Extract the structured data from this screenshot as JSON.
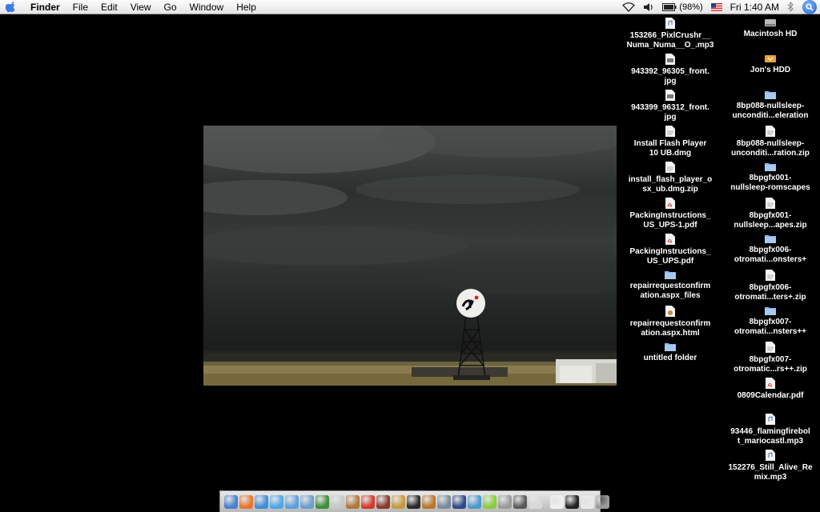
{
  "menubar": {
    "app_name": "Finder",
    "menus": [
      "File",
      "Edit",
      "View",
      "Go",
      "Window",
      "Help"
    ],
    "battery": "(98%)",
    "clock": "Fri 1:40 AM"
  },
  "desktop_left": [
    {
      "label": "153266_PixlCrushr__\nNuma_Numa__O_.mp3",
      "icon": "audio-file-icon"
    },
    {
      "label": "943392_96305_front.\njpg",
      "icon": "image-file-icon"
    },
    {
      "label": "943399_96312_front.\njpg",
      "icon": "image-file-icon"
    },
    {
      "label": "Install Flash Player\n10 UB.dmg",
      "icon": "document-icon"
    },
    {
      "label": "install_flash_player_o\nsx_ub.dmg.zip",
      "icon": "document-icon"
    },
    {
      "label": "PackingInstructions_\nUS_UPS-1.pdf",
      "icon": "pdf-file-icon"
    },
    {
      "label": "PackingInstructions_\nUS_UPS.pdf",
      "icon": "pdf-file-icon"
    },
    {
      "label": "repairrequestconfirm\nation.aspx_files",
      "icon": "folder-icon"
    },
    {
      "label": "repairrequestconfirm\nation.aspx.html",
      "icon": "html-file-icon"
    },
    {
      "label": "untitled folder",
      "icon": "folder-icon"
    }
  ],
  "desktop_right": [
    {
      "label": "Macintosh HD",
      "icon": "hard-drive-icon"
    },
    {
      "label": "Jon's HDD",
      "icon": "external-drive-icon"
    },
    {
      "label": "8bp088-nullsleep-\nunconditi...eleration",
      "icon": "folder-icon"
    },
    {
      "label": "8bp088-nullsleep-\nunconditi...ration.zip",
      "icon": "document-icon"
    },
    {
      "label": "8bpgfx001-\nnullsleep-romscapes",
      "icon": "folder-icon"
    },
    {
      "label": "8bpgfx001-\nnullsleep...apes.zip",
      "icon": "document-icon"
    },
    {
      "label": "8bpgfx006-\notromati...onsters+",
      "icon": "folder-icon"
    },
    {
      "label": "8bpgfx006-\notromati...ters+.zip",
      "icon": "document-icon"
    },
    {
      "label": "8bpgfx007-\notromati...nsters++",
      "icon": "folder-icon"
    },
    {
      "label": "8bpgfx007-\notromatic...rs++.zip",
      "icon": "document-icon"
    },
    {
      "label": "0809Calendar.pdf",
      "icon": "pdf-file-icon"
    },
    {
      "label": "93446_flamingfirebol\nt_mariocastl.mp3",
      "icon": "audio-file-icon"
    },
    {
      "label": "152276_Still_Alive_Re\nmix.mp3",
      "icon": "audio-file-icon"
    }
  ],
  "dock": {
    "apps": [
      {
        "name": "finder-icon",
        "color": "#4a7fd1"
      },
      {
        "name": "firefox-icon",
        "color": "#e8762b"
      },
      {
        "name": "safari-icon",
        "color": "#3b8fd9"
      },
      {
        "name": "ichat-icon",
        "color": "#4aa8e8"
      },
      {
        "name": "itunes-icon",
        "color": "#5aa0e0"
      },
      {
        "name": "mail-icon",
        "color": "#6a9fd0"
      },
      {
        "name": "adium-icon",
        "color": "#3d8f3a"
      },
      {
        "name": "ipod-icon",
        "color": "#c8c8c8"
      },
      {
        "name": "photo-icon",
        "color": "#b3773a"
      },
      {
        "name": "rss-icon",
        "color": "#d23a2a"
      },
      {
        "name": "book-icon",
        "color": "#8a3a2a"
      },
      {
        "name": "pencil-icon",
        "color": "#c89a3a"
      },
      {
        "name": "game-icon",
        "color": "#2a2a2a"
      },
      {
        "name": "guitar-icon",
        "color": "#b9772a"
      },
      {
        "name": "plane-icon",
        "color": "#7a8a9a"
      },
      {
        "name": "globe-icon",
        "color": "#2a4a8a"
      },
      {
        "name": "network-icon",
        "color": "#4a9ad0"
      },
      {
        "name": "lime-icon",
        "color": "#8acd3a"
      },
      {
        "name": "preview-icon",
        "color": "#9a9a9a"
      },
      {
        "name": "utility-icon",
        "color": "#5a5a5a"
      },
      {
        "name": "chess-icon",
        "color": "#d8d8d8"
      }
    ],
    "docs": [
      {
        "name": "document-stack-icon",
        "color": "#f0f0f0"
      },
      {
        "name": "terminal-icon",
        "color": "#222222"
      },
      {
        "name": "file-icon",
        "color": "#e8e8e8"
      },
      {
        "name": "trash-icon",
        "color": "#9a9a9a"
      }
    ]
  }
}
